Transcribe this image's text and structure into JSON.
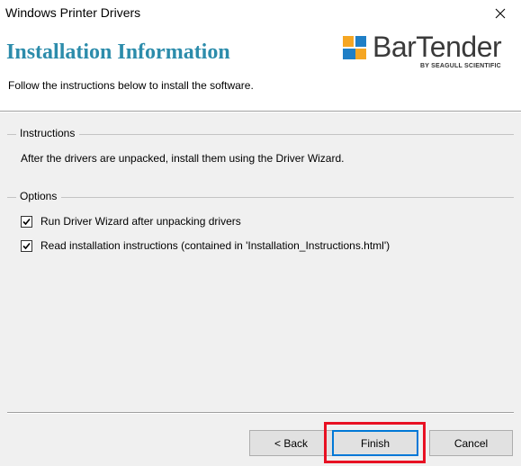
{
  "window": {
    "title": "Windows Printer Drivers"
  },
  "header": {
    "title": "Installation Information",
    "subtitle": "Follow the instructions below to install the software.",
    "logo": {
      "brand": "BarTender",
      "tagline": "BY SEAGULL SCIENTIFIC",
      "colors": {
        "orange": "#f5a623",
        "blue": "#1f7fc6",
        "text": "#3a3a3a"
      }
    }
  },
  "instructions": {
    "label": "Instructions",
    "text": "After the drivers are unpacked, install them using the Driver Wizard."
  },
  "options": {
    "label": "Options",
    "items": [
      {
        "label": "Run Driver Wizard after unpacking drivers",
        "checked": true
      },
      {
        "label": "Read installation instructions (contained in 'Installation_Instructions.html')",
        "checked": true
      }
    ]
  },
  "buttons": {
    "back": "< Back",
    "finish": "Finish",
    "cancel": "Cancel"
  },
  "colors": {
    "title_accent": "#2c8cab",
    "highlight": "#e81123",
    "default_button_border": "#0078d7"
  }
}
